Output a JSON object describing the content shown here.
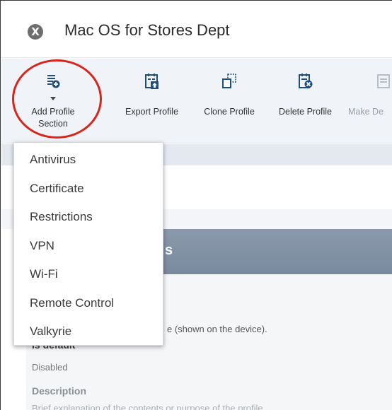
{
  "window": {
    "title": "Mac OS for Stores Dept",
    "os_glyph": "X"
  },
  "toolbar": {
    "buttons": [
      {
        "id": "add",
        "line1": "Add Profile",
        "line2": "Section",
        "icon": "add-section-icon",
        "disabled": false
      },
      {
        "id": "export",
        "label": "Export Profile",
        "icon": "export-icon",
        "disabled": false
      },
      {
        "id": "clone",
        "label": "Clone Profile",
        "icon": "clone-icon",
        "disabled": false
      },
      {
        "id": "delete",
        "label": "Delete Profile",
        "icon": "delete-icon",
        "disabled": false
      },
      {
        "id": "make_default",
        "label": "Make De",
        "icon": "make-default-icon",
        "disabled": true
      }
    ],
    "highlight_color": "#d9251c"
  },
  "dropdown": {
    "items": [
      "Antivirus",
      "Certificate",
      "Restrictions",
      "VPN",
      "Wi-Fi",
      "Remote Control",
      "Valkyrie"
    ]
  },
  "section": {
    "header_partial": "s"
  },
  "fields": {
    "name_hint_partial": "e (shown on the device).",
    "is_default_label": "Is default",
    "is_default_value": "Disabled",
    "description_label": "Description",
    "description_value": "Brief explanation of the contents or purpose of the profile"
  }
}
